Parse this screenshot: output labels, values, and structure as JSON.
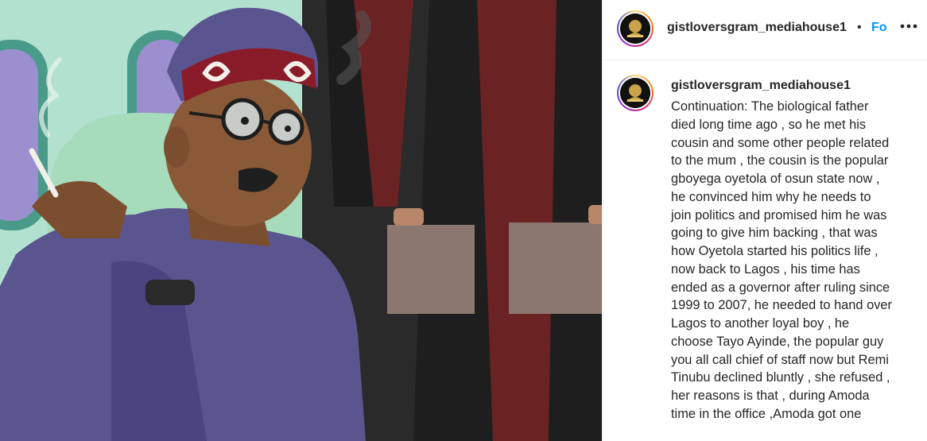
{
  "post": {
    "username": "gistloversgram_mediahouse1",
    "separator": "•",
    "follow_label": "Follow",
    "more_icon": "more-horizontal-icon",
    "caption": "Continuation: The biological father\ndied long time ago , so he met his\ncousin and some other people related\nto the mum , the cousin is the popular\ngboyega oyetola of osun state now ,\nhe convinced him why he needs to\njoin politics and promised him he was\ngoing to give him backing , that was\nhow Oyetola started his politics life ,\nnow back to Lagos , his time has\nended as a governor after ruling since\n1999 to 2007, he needed to hand over\nLagos to another loyal boy , he\nchoose Tayo Ayinde, the popular guy\nyou all call chief of staff now but Remi\nTinubu declined bluntly , she refused ,\nher reasons is that , during Amoda\ntime in the office ,Amoda got one"
  },
  "colors": {
    "username": "#262626",
    "follow": "#0095f6",
    "border": "#efefef",
    "story_ring": [
      "#feda75",
      "#fa7e1e",
      "#d62976",
      "#962fbf",
      "#4f5bd5"
    ]
  }
}
